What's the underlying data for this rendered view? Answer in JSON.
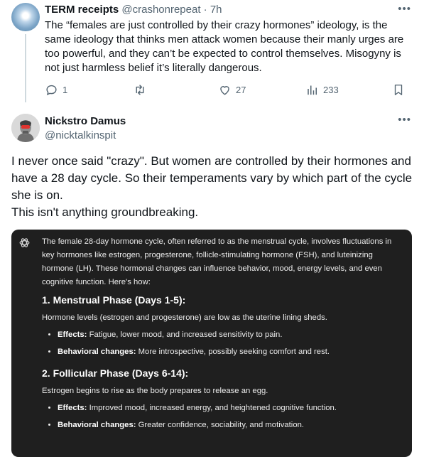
{
  "parent_post": {
    "display_name": "TERM receipts",
    "handle": "@crashonrepeat",
    "separator": "·",
    "time": "7h",
    "text": "The “females are just controlled by their crazy hormones” ideology, is the same ideology that thinks men attack women because their manly urges are too powerful, and they can’t be expected to control themselves. Misogyny is not just harmless belief it’s literally dangerous.",
    "reply_count": "1",
    "like_count": "27",
    "view_count": "233"
  },
  "reply": {
    "display_name": "Nickstro Damus",
    "handle": "@nicktalkinspit",
    "paragraphs": [
      "I never once said \"crazy\". But women are controlled by their hormones and have a 28 day cycle.  So their temperaments vary by which part of the cycle she is on.",
      "This isn't anything groundbreaking."
    ]
  },
  "screenshot_card": {
    "intro": "The female 28-day hormone cycle, often referred to as the menstrual cycle, involves fluctuations in key hormones like estrogen, progesterone, follicle-stimulating hormone (FSH), and luteinizing hormone (LH). These hormonal changes can influence behavior, mood, energy levels, and even cognitive function. Here's how:",
    "sections": [
      {
        "heading": "1. Menstrual Phase (Days 1-5):",
        "desc": "Hormone levels (estrogen and progesterone) are low as the uterine lining sheds.",
        "bullets": [
          {
            "label": "Effects:",
            "text": " Fatigue, lower mood, and increased sensitivity to pain."
          },
          {
            "label": "Behavioral changes:",
            "text": " More introspective, possibly seeking comfort and rest."
          }
        ]
      },
      {
        "heading": "2. Follicular Phase (Days 6-14):",
        "desc": "Estrogen begins to rise as the body prepares to release an egg.",
        "bullets": [
          {
            "label": "Effects:",
            "text": " Improved mood, increased energy, and heightened cognitive function."
          },
          {
            "label": "Behavioral changes:",
            "text": " Greater confidence, sociability, and motivation."
          }
        ]
      }
    ]
  },
  "icons": {
    "more": "more-dots-icon",
    "reply": "reply-bubble-icon",
    "repost": "repost-icon",
    "like": "heart-icon",
    "views": "views-bars-icon",
    "bookmark": "bookmark-icon",
    "chatgpt": "chatgpt-logo-icon"
  },
  "colors": {
    "text_primary": "#0f1419",
    "text_secondary": "#536471",
    "card_bg": "#1f1f1f",
    "card_text": "#ececec"
  }
}
